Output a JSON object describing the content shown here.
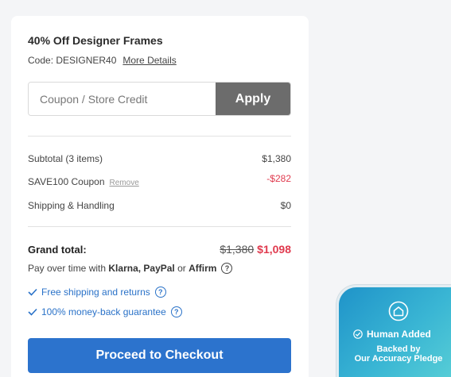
{
  "promo": {
    "title": "40% Off Designer Frames",
    "code_text": "Code: DESIGNER40",
    "more_details": "More Details"
  },
  "coupon": {
    "placeholder": "Coupon / Store Credit",
    "value": "",
    "apply_label": "Apply"
  },
  "summary": {
    "subtotal_label": "Subtotal (3 items)",
    "subtotal_value": "$1,380",
    "coupon_label": "SAVE100 Coupon",
    "coupon_remove": "Remove",
    "coupon_value": "-$282",
    "shipping_label": "Shipping & Handling",
    "shipping_value": "$0"
  },
  "grand": {
    "label": "Grand total:",
    "old_price": "$1,380",
    "new_price": "$1,098"
  },
  "payover": {
    "prefix": "Pay over time with",
    "providers": "Klarna, PayPal",
    "joiner": "or",
    "last_provider": "Affirm",
    "help_icon": "?"
  },
  "benefits": [
    {
      "label": "Free shipping and returns",
      "icon": "check-icon"
    },
    {
      "label": "100% money-back guarantee",
      "icon": "check-icon"
    }
  ],
  "checkout": {
    "label": "Proceed to Checkout"
  },
  "pledge": {
    "headline": "Human Added",
    "line1": "Backed by",
    "line2": "Our Accuracy Pledge"
  },
  "colors": {
    "accent_blue": "#2c73cd",
    "discount_red": "#e03a4e",
    "apply_gray": "#6c6c6c"
  }
}
